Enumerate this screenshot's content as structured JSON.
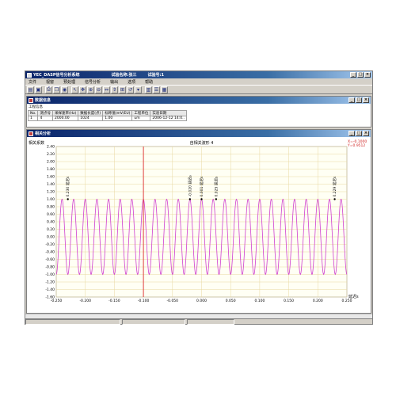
{
  "window": {
    "title": "YEC_DASP信号分析系统",
    "test_name": "试验名称:张三",
    "test_no": "试验号:1"
  },
  "menu": [
    "文件",
    "视窗",
    "预处理",
    "信号分析",
    "输出",
    "选项",
    "帮助"
  ],
  "toolbar_icons": [
    "open-icon",
    "save-icon",
    "print-icon",
    "copy-icon",
    "color-icon",
    "cursor-icon",
    "hand-icon",
    "zoom-in-icon",
    "zoom-out-icon",
    "zoom-x-icon",
    "zoom-y-icon",
    "zoom-all-icon",
    "undo-icon",
    "dropdown-icon",
    "chart-icon",
    "list-icon",
    "grid-icon"
  ],
  "data_panel": {
    "title": "数据信息",
    "section_label": "工程信息",
    "columns": [
      "No.",
      "测点号",
      "采样速率(Hz)",
      "数据长度(点)",
      "标称值(mV/EU)",
      "工程单位",
      "实验日期"
    ],
    "row": [
      "1",
      "4",
      "2000.00",
      "1024",
      "1.00",
      "um",
      "2006-12-12 14:0.."
    ]
  },
  "analysis_panel": {
    "title": "相关分析"
  },
  "chart_data": {
    "type": "line",
    "title": "自相关波形 4",
    "ylabel": "相关系数",
    "xlabel": "延迟s",
    "xlim": [
      -0.25,
      0.25
    ],
    "ylim": [
      -1.6,
      2.4
    ],
    "xticks": [
      "-0.250",
      "-0.200",
      "-0.150",
      "-0.100",
      "-0.050",
      "0.000",
      "0.050",
      "0.100",
      "0.150",
      "0.200",
      "0.250"
    ],
    "yticks": [
      "2.40",
      "2.20",
      "2.00",
      "1.80",
      "1.60",
      "1.40",
      "1.20",
      "1.00",
      "0.80",
      "0.60",
      "0.40",
      "0.20",
      "0.00",
      "-0.20",
      "-0.40",
      "-0.60",
      "-0.80",
      "-1.00",
      "-1.20",
      "-1.40",
      "-1.60"
    ],
    "series": [
      {
        "period": 0.02,
        "amplitude": 1.0,
        "color": "#d040d0"
      }
    ],
    "cursor_x": -0.1,
    "cursor_readout": [
      "X=-0.1000",
      "Y=0.9512"
    ],
    "peak_labels": [
      {
        "x": -0.23,
        "text": "0.230 延迟s"
      },
      {
        "x": -0.02,
        "text": "-0.020 延迟s"
      },
      {
        "x": 0.025,
        "text": "0.025 延迟s"
      },
      {
        "x": 0.0,
        "text": "0.001 延迟s"
      },
      {
        "x": 0.229,
        "text": "0.229 延迟s"
      }
    ],
    "grid": true
  },
  "colors": {
    "title_bar": "#0a246a",
    "curve": "#d040d0",
    "cursor": "#e04040",
    "grid": "#e8d8a0",
    "plot_bg": "#fffff4"
  }
}
